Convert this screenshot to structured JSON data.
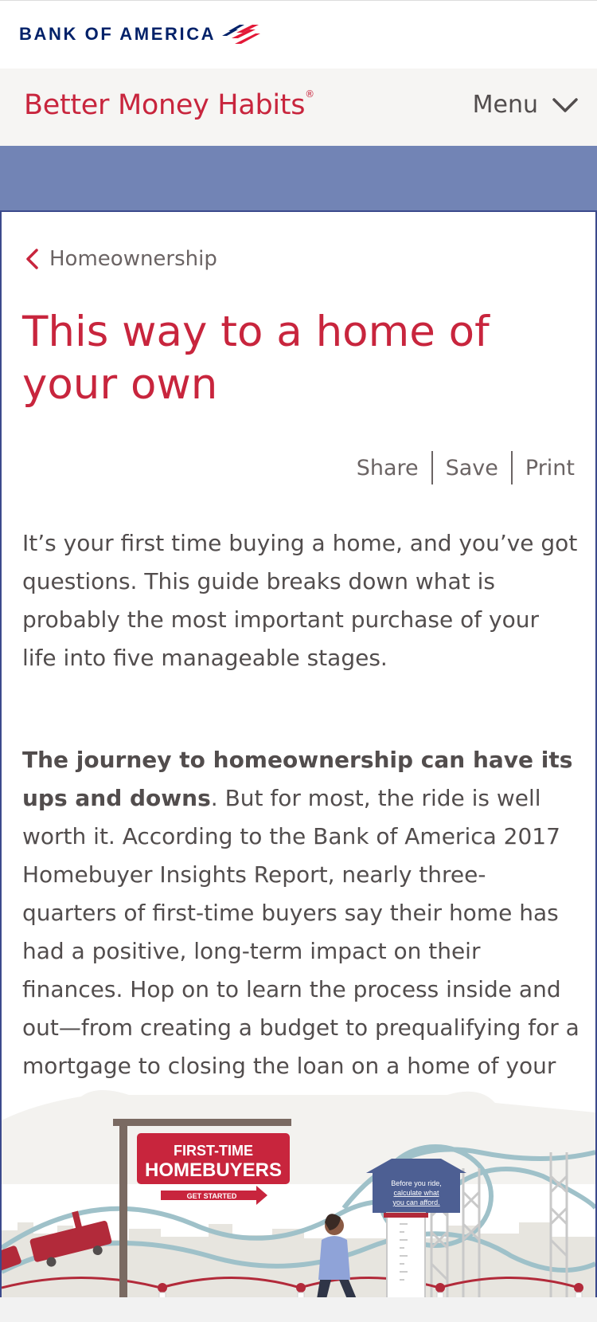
{
  "brand": {
    "bank_name": "BANK OF AMERICA",
    "site_name": "Better Money Habits",
    "site_mark": "®"
  },
  "nav": {
    "menu_label": "Menu"
  },
  "breadcrumb": {
    "label": "Homeownership"
  },
  "article": {
    "title": "This way to a home of your own",
    "actions": {
      "share": "Share",
      "save": "Save",
      "print": "Print"
    },
    "paragraph1": "It’s your first time buying a home, and you’ve got questions. This guide breaks down what is probably the most important purchase of your life into five manageable stages.",
    "paragraph2_bold": "The journey to homeownership can have its ups and downs",
    "paragraph2_rest": ". But for most, the ride is well worth it. According to the Bank of America 2017 Homebuyer Insights Report, nearly three-quarters of first-time buyers say their home has had a positive, long-term impact on their finances. Hop on to learn the process inside and out—from creating a budget to prequalifying for a mortgage to closing the loan on a home of your own."
  },
  "illustration": {
    "sign_line1": "FIRST-TIME",
    "sign_line2": "HOMEBUYERS",
    "sign_cta": "GET STARTED",
    "booth_line1": "Before you ride,",
    "booth_line2": "calculate what",
    "booth_line3": "you can afford."
  },
  "colors": {
    "brand_red": "#c8253d",
    "brand_navy": "#012169",
    "band_blue": "#7284b5",
    "text_gray": "#524d4d"
  }
}
